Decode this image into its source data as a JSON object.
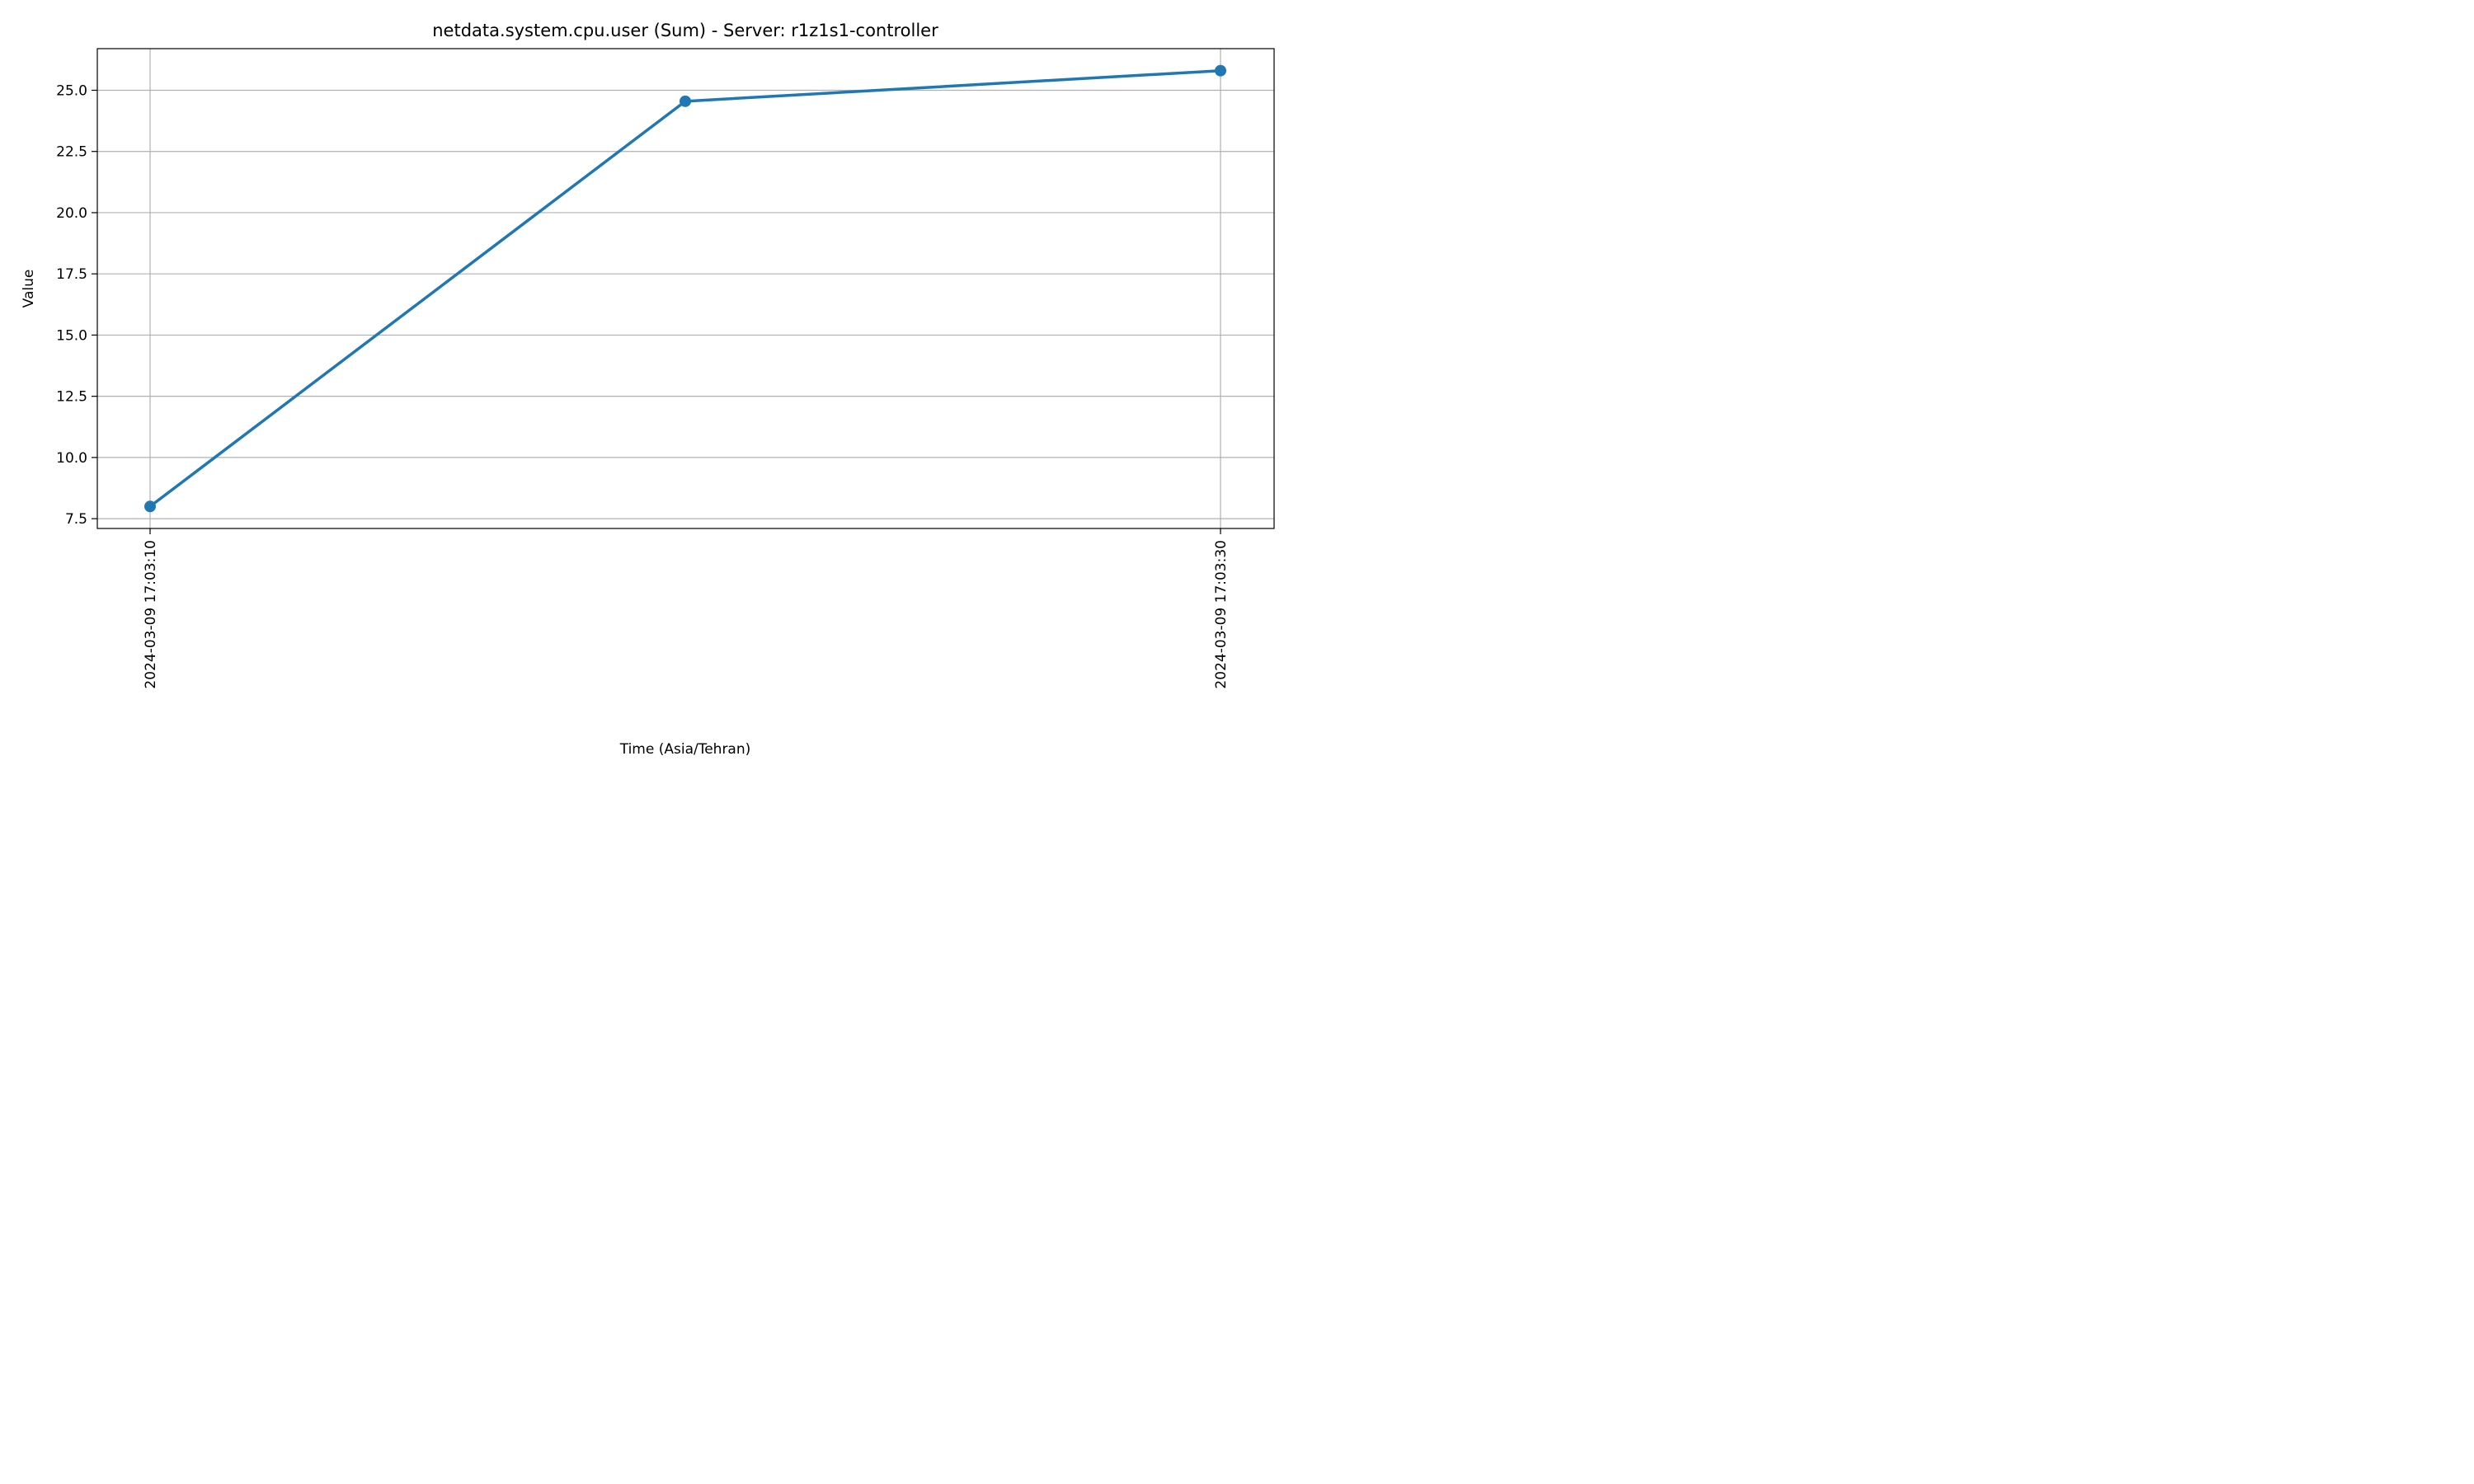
{
  "chart_data": {
    "type": "line",
    "title": "netdata.system.cpu.user (Sum) - Server: r1z1s1-controller",
    "xlabel": "Time (Asia/Tehran)",
    "ylabel": "Value",
    "x": [
      "2024-03-09 17:03:10",
      "2024-03-09 17:03:20",
      "2024-03-09 17:03:30"
    ],
    "x_tick_labels": [
      "2024-03-09 17:03:10",
      "2024-03-09 17:03:30"
    ],
    "series": [
      {
        "values": [
          8.0,
          24.55,
          25.8
        ],
        "color": "#1f77b4"
      }
    ],
    "y_ticks": [
      "7.5",
      "10.0",
      "12.5",
      "15.0",
      "17.5",
      "20.0",
      "22.5",
      "25.0"
    ],
    "ylim": [
      7.1,
      26.7
    ],
    "grid": true,
    "legend": "none"
  }
}
